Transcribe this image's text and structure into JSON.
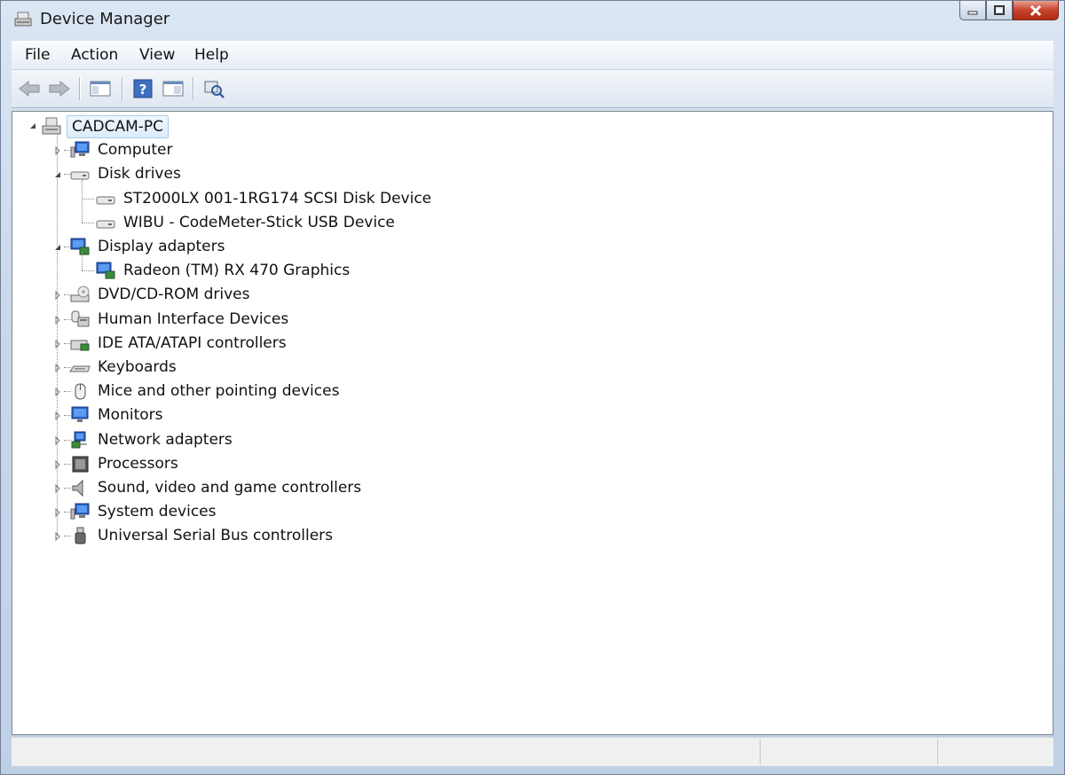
{
  "window": {
    "title": "Device Manager"
  },
  "menu": {
    "file": "File",
    "action": "Action",
    "view": "View",
    "help": "Help"
  },
  "tree": {
    "root": "CADCAM-PC",
    "categories": [
      {
        "label": "Computer",
        "icon": "computer-icon",
        "expanded": false
      },
      {
        "label": "Disk drives",
        "icon": "disk-drive-icon",
        "expanded": true,
        "children": [
          "ST2000LX 001-1RG174 SCSI Disk Device",
          "WIBU - CodeMeter-Stick USB Device"
        ]
      },
      {
        "label": "Display adapters",
        "icon": "display-adapter-icon",
        "expanded": true,
        "children": [
          "Radeon (TM) RX 470 Graphics"
        ]
      },
      {
        "label": "DVD/CD-ROM drives",
        "icon": "dvd-drive-icon",
        "expanded": false
      },
      {
        "label": "Human Interface Devices",
        "icon": "hid-icon",
        "expanded": false
      },
      {
        "label": "IDE ATA/ATAPI controllers",
        "icon": "ide-controller-icon",
        "expanded": false
      },
      {
        "label": "Keyboards",
        "icon": "keyboard-icon",
        "expanded": false
      },
      {
        "label": "Mice and other pointing devices",
        "icon": "mouse-icon",
        "expanded": false
      },
      {
        "label": "Monitors",
        "icon": "monitor-icon",
        "expanded": false
      },
      {
        "label": "Network adapters",
        "icon": "network-adapter-icon",
        "expanded": false
      },
      {
        "label": "Processors",
        "icon": "processor-icon",
        "expanded": false
      },
      {
        "label": "Sound, video and game controllers",
        "icon": "speaker-icon",
        "expanded": false
      },
      {
        "label": "System devices",
        "icon": "system-devices-icon",
        "expanded": false
      },
      {
        "label": "Universal Serial Bus controllers",
        "icon": "usb-icon",
        "expanded": false
      }
    ]
  },
  "colors": {
    "selection_fill": "#dcecfb",
    "selection_border": "#a8cdea",
    "close_button": "#c8432b"
  }
}
